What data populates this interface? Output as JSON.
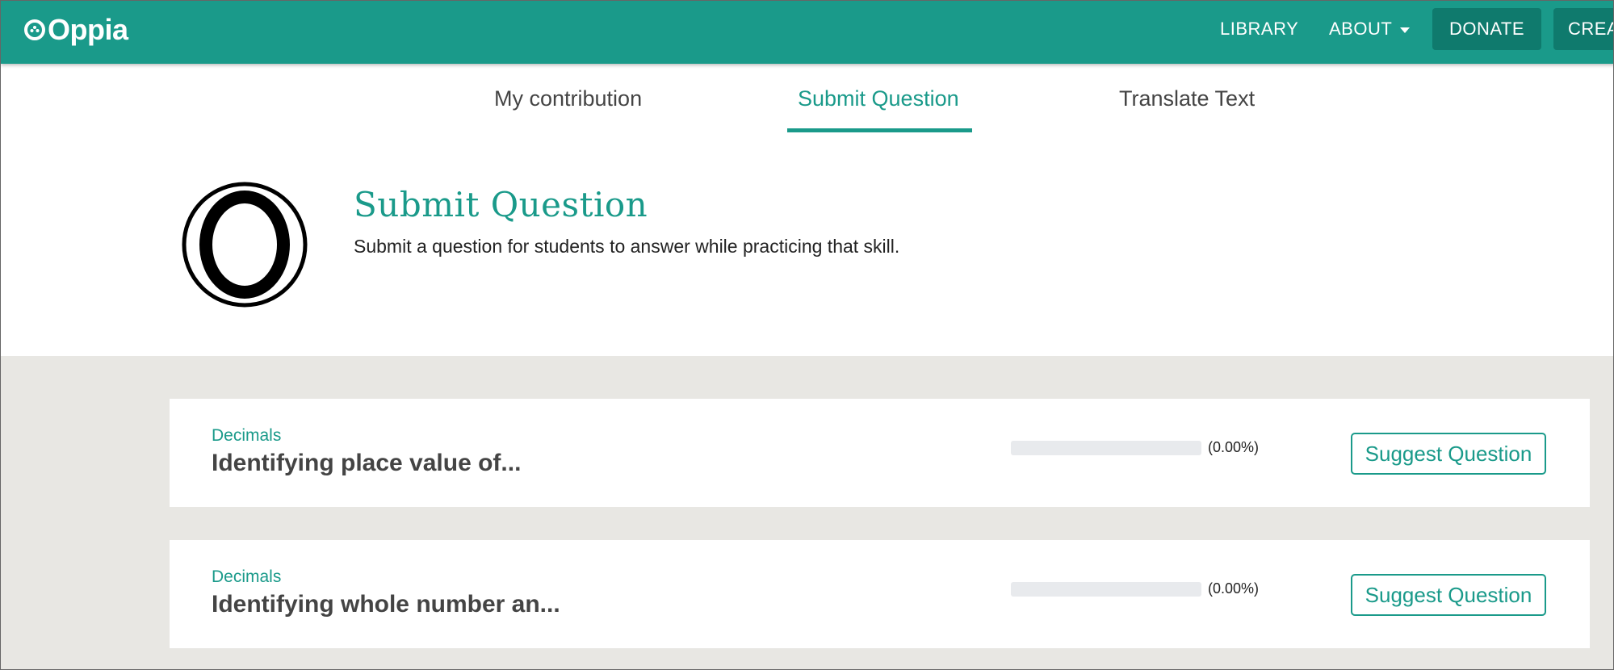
{
  "nav": {
    "logo_text": "Oppia",
    "library": "LIBRARY",
    "about": "ABOUT",
    "donate": "DONATE",
    "create": "CREA"
  },
  "tabs": [
    {
      "label": "My contribution",
      "active": false
    },
    {
      "label": "Submit Question",
      "active": true
    },
    {
      "label": "Translate Text",
      "active": false
    }
  ],
  "header": {
    "title": "Submit Question",
    "description": "Submit a question for students to answer while practicing that skill.",
    "icon": "submit-question-ring-icon"
  },
  "opportunities": [
    {
      "topic": "Decimals",
      "skill": "Identifying place value of...",
      "progress_percent": 0,
      "progress_text": "(0.00%)",
      "button_label": "Suggest Question"
    },
    {
      "topic": "Decimals",
      "skill": "Identifying whole number an...",
      "progress_percent": 0,
      "progress_text": "(0.00%)",
      "button_label": "Suggest Question"
    }
  ],
  "colors": {
    "brand": "#1a9a8a",
    "brand_dark": "#0f7a6d",
    "grey_bg": "#e8e7e3",
    "progress_track": "#e8eaed"
  }
}
